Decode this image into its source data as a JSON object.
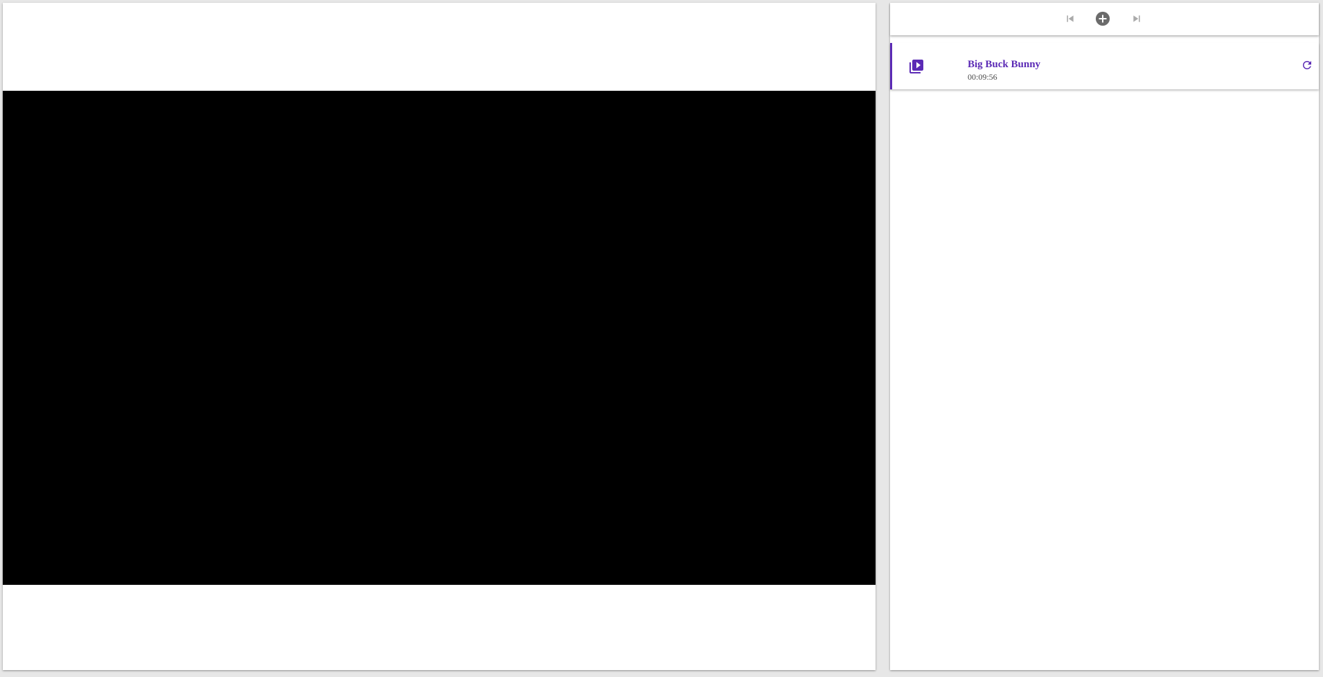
{
  "player": {
    "video_background": "#000000"
  },
  "controls": {
    "prev_icon": "skip-previous-icon",
    "add_icon": "add-circle-icon",
    "next_icon": "skip-next-icon",
    "disabled_color": "#aaaaaa",
    "add_color": "#6b6b6b"
  },
  "playlist": {
    "items": [
      {
        "title": "Big Buck Bunny",
        "duration": "00:09:56",
        "icon": "video-library-icon",
        "action_icon": "refresh-icon",
        "active": true
      }
    ],
    "accent": "#5b2ab5"
  }
}
